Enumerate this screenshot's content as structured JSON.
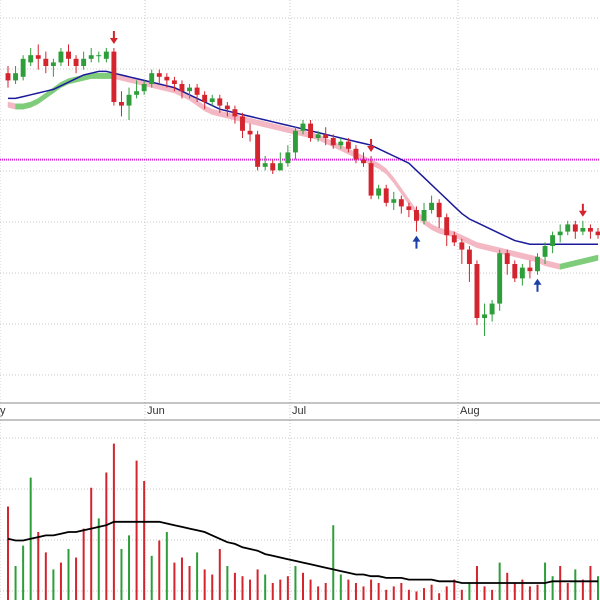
{
  "chart_data": {
    "type": "candlestick",
    "x_tick_labels": [
      "y",
      "Jun",
      "Jul",
      "Aug"
    ],
    "grid": true,
    "price_panel": {
      "y_range": [
        0,
        100
      ],
      "reference_line": 64,
      "candles": [
        [
          88,
          86,
          90,
          84
        ],
        [
          86,
          88,
          90,
          85
        ],
        [
          87,
          92,
          93,
          86
        ],
        [
          91,
          93,
          95,
          90
        ],
        [
          93,
          92,
          96,
          89
        ],
        [
          92,
          90,
          94,
          88
        ],
        [
          90,
          91,
          92,
          87
        ],
        [
          91,
          94,
          95,
          90
        ],
        [
          94,
          92,
          96,
          90
        ],
        [
          92,
          90,
          93,
          88
        ],
        [
          90,
          92,
          94,
          89
        ],
        [
          92,
          93,
          95,
          91
        ],
        [
          93,
          93,
          94,
          91
        ],
        [
          92,
          94,
          95,
          91
        ],
        [
          94,
          80,
          95,
          79
        ],
        [
          80,
          79,
          83,
          76
        ],
        [
          79,
          82,
          84,
          75
        ],
        [
          82,
          83,
          86,
          81
        ],
        [
          83,
          85,
          86,
          82
        ],
        [
          85,
          88,
          89,
          84
        ],
        [
          88,
          87,
          89,
          85
        ],
        [
          87,
          86,
          88,
          84
        ],
        [
          86,
          85,
          87,
          83
        ],
        [
          85,
          83,
          86,
          81
        ],
        [
          83,
          84,
          85,
          81
        ],
        [
          84,
          82,
          85,
          80
        ],
        [
          82,
          80,
          83,
          78
        ],
        [
          80,
          81,
          82,
          79
        ],
        [
          81,
          79,
          82,
          77
        ],
        [
          79,
          78,
          80,
          76
        ],
        [
          78,
          76,
          79,
          74
        ],
        [
          76,
          72,
          77,
          70
        ],
        [
          72,
          71,
          74,
          69
        ],
        [
          71,
          62,
          72,
          61
        ],
        [
          62,
          63,
          65,
          61
        ],
        [
          63,
          61,
          64,
          60
        ],
        [
          61,
          63,
          66,
          61
        ],
        [
          63,
          66,
          68,
          62
        ],
        [
          66,
          72,
          73,
          64
        ],
        [
          72,
          74,
          75,
          71
        ],
        [
          74,
          70,
          75,
          69
        ],
        [
          70,
          71,
          72,
          69
        ],
        [
          71,
          70,
          73,
          68
        ],
        [
          70,
          68,
          71,
          67
        ],
        [
          68,
          69,
          70,
          67
        ],
        [
          69,
          67,
          70,
          66
        ],
        [
          67,
          64,
          68,
          63
        ],
        [
          64,
          63,
          66,
          62
        ],
        [
          63,
          54,
          65,
          53
        ],
        [
          54,
          56,
          57,
          53
        ],
        [
          56,
          52,
          57,
          51
        ],
        [
          52,
          53,
          55,
          50
        ],
        [
          53,
          51,
          54,
          49
        ],
        [
          51,
          50,
          52,
          48
        ],
        [
          50,
          47,
          51,
          44
        ],
        [
          47,
          50,
          52,
          46
        ],
        [
          50,
          52,
          54,
          49
        ],
        [
          52,
          48,
          53,
          45
        ],
        [
          48,
          43,
          49,
          40
        ],
        [
          43,
          41,
          44,
          40
        ],
        [
          41,
          39,
          42,
          35
        ],
        [
          39,
          35,
          40,
          30
        ],
        [
          35,
          20,
          36,
          18
        ],
        [
          20,
          21,
          24,
          15
        ],
        [
          21,
          24,
          25,
          19
        ],
        [
          24,
          38,
          39,
          22
        ],
        [
          38,
          35,
          39,
          32
        ],
        [
          35,
          31,
          36,
          30
        ],
        [
          31,
          34,
          35,
          29
        ],
        [
          34,
          33,
          36,
          31
        ],
        [
          33,
          37,
          38,
          32
        ],
        [
          37,
          40,
          41,
          35
        ],
        [
          40,
          43,
          44,
          38
        ],
        [
          43,
          44,
          46,
          41
        ],
        [
          44,
          46,
          47,
          43
        ],
        [
          46,
          44,
          47,
          42
        ],
        [
          44,
          45,
          47,
          43
        ],
        [
          45,
          44,
          46,
          42
        ],
        [
          44,
          43,
          45,
          42
        ]
      ],
      "sma": [
        81,
        81,
        81.5,
        82,
        82.5,
        83,
        83.5,
        84.5,
        85.5,
        86.5,
        87.5,
        88,
        88.5,
        88.5,
        88,
        87.5,
        87,
        86.5,
        86,
        85.5,
        85,
        84.5,
        84,
        83,
        82,
        81,
        80,
        79,
        78,
        77.5,
        77,
        76.5,
        76,
        75.5,
        75,
        74.5,
        74,
        73.5,
        73,
        72.5,
        72,
        71.5,
        71,
        70.5,
        70,
        69.5,
        69,
        68.5,
        68,
        67,
        66,
        65,
        64,
        63,
        61,
        59,
        57,
        55,
        53,
        51,
        49,
        47.5,
        46.5,
        45.5,
        44.5,
        43.5,
        42.5,
        41.5,
        41,
        40.5,
        40.5,
        40.5,
        40.5,
        40.5,
        40.5,
        40.5,
        40.5,
        40.5,
        40.5
      ],
      "ema_band_upper": [
        80,
        79.5,
        79.5,
        80,
        81,
        82.5,
        84,
        85.5,
        86.5,
        87,
        87.5,
        88,
        88,
        88,
        88,
        87.5,
        87,
        86.5,
        86,
        85.5,
        85,
        84.5,
        84,
        83,
        82,
        80.5,
        79,
        78,
        77.5,
        77,
        76.5,
        76,
        75.5,
        75,
        74.5,
        74,
        73.5,
        73,
        72.5,
        72,
        71.5,
        71,
        70,
        69,
        68,
        67,
        66,
        65,
        64,
        63,
        61.5,
        59,
        56,
        53,
        50,
        47.5,
        46,
        45,
        44.5,
        44,
        43,
        42,
        41,
        40.5,
        40,
        39.5,
        39,
        38.5,
        38,
        37.5,
        37,
        36,
        35.5,
        35,
        35.5,
        36,
        36.5,
        37,
        37.5
      ],
      "ema_band_lower": [
        78.5,
        78,
        78,
        78.5,
        79.5,
        81,
        82.5,
        84,
        85,
        85.5,
        86,
        86.5,
        86.5,
        86.5,
        86.5,
        86,
        85.5,
        85,
        84.5,
        84,
        83.5,
        83,
        82.5,
        81.5,
        80.5,
        79,
        77.5,
        76.5,
        76,
        75.5,
        75,
        74.5,
        74,
        73.5,
        73,
        72.5,
        72,
        71.5,
        71,
        70.5,
        70,
        69.5,
        68.5,
        67.5,
        66.5,
        65.5,
        64.5,
        63.5,
        62.5,
        61.5,
        60,
        57.5,
        54.5,
        51.5,
        48.5,
        46,
        44.5,
        43.5,
        43,
        42.5,
        41.5,
        40.5,
        39.5,
        39,
        38.5,
        38,
        37.5,
        37,
        36.5,
        36,
        35.5,
        34.5,
        34,
        33.5,
        34,
        34.5,
        35,
        35.5,
        36
      ],
      "signals": [
        {
          "index": 14,
          "type": "sell"
        },
        {
          "index": 54,
          "type": "buy"
        },
        {
          "index": 48,
          "type": "sell"
        },
        {
          "index": 70,
          "type": "buy"
        },
        {
          "index": 76,
          "type": "sell"
        }
      ]
    },
    "volume_panel": {
      "y_range": [
        0,
        100
      ],
      "bars": [
        {
          "value": 55,
          "up": false
        },
        {
          "value": 20,
          "up": true
        },
        {
          "value": 32,
          "up": true
        },
        {
          "value": 72,
          "up": true
        },
        {
          "value": 40,
          "up": false
        },
        {
          "value": 28,
          "up": false
        },
        {
          "value": 18,
          "up": true
        },
        {
          "value": 22,
          "up": false
        },
        {
          "value": 30,
          "up": true
        },
        {
          "value": 25,
          "up": false
        },
        {
          "value": 42,
          "up": false
        },
        {
          "value": 66,
          "up": false
        },
        {
          "value": 48,
          "up": true
        },
        {
          "value": 75,
          "up": false
        },
        {
          "value": 92,
          "up": false
        },
        {
          "value": 30,
          "up": true
        },
        {
          "value": 38,
          "up": true
        },
        {
          "value": 82,
          "up": false
        },
        {
          "value": 70,
          "up": false
        },
        {
          "value": 26,
          "up": true
        },
        {
          "value": 35,
          "up": false
        },
        {
          "value": 40,
          "up": true
        },
        {
          "value": 22,
          "up": false
        },
        {
          "value": 25,
          "up": false
        },
        {
          "value": 20,
          "up": false
        },
        {
          "value": 28,
          "up": true
        },
        {
          "value": 18,
          "up": false
        },
        {
          "value": 15,
          "up": false
        },
        {
          "value": 30,
          "up": false
        },
        {
          "value": 20,
          "up": true
        },
        {
          "value": 16,
          "up": false
        },
        {
          "value": 14,
          "up": false
        },
        {
          "value": 12,
          "up": false
        },
        {
          "value": 18,
          "up": false
        },
        {
          "value": 15,
          "up": true
        },
        {
          "value": 10,
          "up": false
        },
        {
          "value": 12,
          "up": false
        },
        {
          "value": 14,
          "up": false
        },
        {
          "value": 20,
          "up": true
        },
        {
          "value": 16,
          "up": false
        },
        {
          "value": 12,
          "up": false
        },
        {
          "value": 8,
          "up": false
        },
        {
          "value": 10,
          "up": false
        },
        {
          "value": 44,
          "up": true
        },
        {
          "value": 15,
          "up": true
        },
        {
          "value": 12,
          "up": false
        },
        {
          "value": 10,
          "up": false
        },
        {
          "value": 8,
          "up": false
        },
        {
          "value": 12,
          "up": false
        },
        {
          "value": 10,
          "up": false
        },
        {
          "value": 6,
          "up": false
        },
        {
          "value": 8,
          "up": false
        },
        {
          "value": 10,
          "up": false
        },
        {
          "value": 6,
          "up": false
        },
        {
          "value": 5,
          "up": false
        },
        {
          "value": 7,
          "up": false
        },
        {
          "value": 9,
          "up": false
        },
        {
          "value": 4,
          "up": false
        },
        {
          "value": 8,
          "up": false
        },
        {
          "value": 12,
          "up": false
        },
        {
          "value": 6,
          "up": false
        },
        {
          "value": 10,
          "up": true
        },
        {
          "value": 20,
          "up": false
        },
        {
          "value": 8,
          "up": false
        },
        {
          "value": 6,
          "up": false
        },
        {
          "value": 22,
          "up": true
        },
        {
          "value": 16,
          "up": false
        },
        {
          "value": 10,
          "up": false
        },
        {
          "value": 12,
          "up": false
        },
        {
          "value": 8,
          "up": false
        },
        {
          "value": 9,
          "up": false
        },
        {
          "value": 22,
          "up": true
        },
        {
          "value": 14,
          "up": true
        },
        {
          "value": 20,
          "up": false
        },
        {
          "value": 10,
          "up": false
        },
        {
          "value": 18,
          "up": true
        },
        {
          "value": 12,
          "up": false
        },
        {
          "value": 20,
          "up": false
        },
        {
          "value": 14,
          "up": true
        }
      ],
      "ma": [
        36,
        35,
        35,
        36,
        37,
        38,
        38,
        39,
        40,
        40,
        41,
        42,
        43,
        44,
        46,
        46,
        46,
        46,
        46,
        46,
        46,
        45,
        44,
        43,
        42,
        41,
        40,
        38,
        36,
        34,
        33,
        31,
        30,
        29,
        27,
        26,
        25,
        24,
        23,
        22,
        21,
        20,
        19,
        18,
        17,
        16,
        15,
        15,
        14,
        14,
        13,
        13,
        13,
        12,
        12,
        12,
        12,
        11,
        11,
        11,
        10,
        10,
        10,
        10,
        10,
        10,
        10,
        10,
        10,
        10,
        10,
        10,
        11,
        11,
        11,
        11,
        11,
        11,
        11
      ]
    },
    "colors": {
      "up": "#2e9e3a",
      "down": "#d4242e",
      "sma": "#1a1a9a",
      "band_pink": "#f4b8c4",
      "band_green": "#7fcc7a",
      "reference_line": "#dd22dd",
      "volume_ma": "#000000",
      "grid": "#c8c8c8",
      "buy_arrow": "#1b3fa8",
      "sell_arrow": "#d4242e"
    }
  }
}
